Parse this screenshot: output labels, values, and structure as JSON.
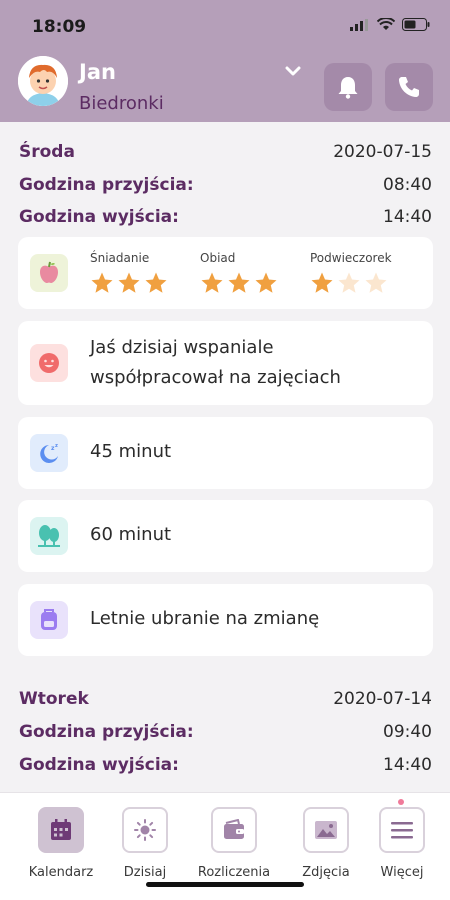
{
  "status_bar": {
    "time": "18:09"
  },
  "header": {
    "child_name": "Jan",
    "group": "Biedronki"
  },
  "days": [
    {
      "day": "Środa",
      "date": "2020-07-15",
      "arrival_label": "Godzina przyjścia:",
      "arrival": "08:40",
      "departure_label": "Godzina wyjścia:",
      "departure": "14:40",
      "meals": [
        {
          "label": "Śniadanie",
          "rating": 3,
          "max": 3
        },
        {
          "label": "Obiad",
          "rating": 3,
          "max": 3
        },
        {
          "label": "Podwieczorek",
          "rating": 1,
          "max": 3
        }
      ],
      "note": "Jaś dzisiaj wspaniale współpracował na zajęciach",
      "sleep": "45 minut",
      "outdoor": "60 minut",
      "clothes": "Letnie ubranie na zmianę"
    },
    {
      "day": "Wtorek",
      "date": "2020-07-14",
      "arrival_label": "Godzina przyjścia:",
      "arrival": "09:40",
      "departure_label": "Godzina wyjścia:",
      "departure": "14:40"
    }
  ],
  "tabs": [
    {
      "label": "Kalendarz",
      "icon": "calendar-icon",
      "active": true
    },
    {
      "label": "Dzisiaj",
      "icon": "sun-icon",
      "active": false
    },
    {
      "label": "Rozliczenia",
      "icon": "wallet-icon",
      "active": false
    },
    {
      "label": "Zdjęcia",
      "icon": "image-icon",
      "active": false
    },
    {
      "label": "Więcej",
      "icon": "menu-icon",
      "active": false
    }
  ],
  "colors": {
    "header_bg": "#b59fb9",
    "accent": "#5c2c63",
    "star_filled": "#f0a040",
    "star_empty": "#fbe6cf",
    "background": "#f3f2f4"
  }
}
